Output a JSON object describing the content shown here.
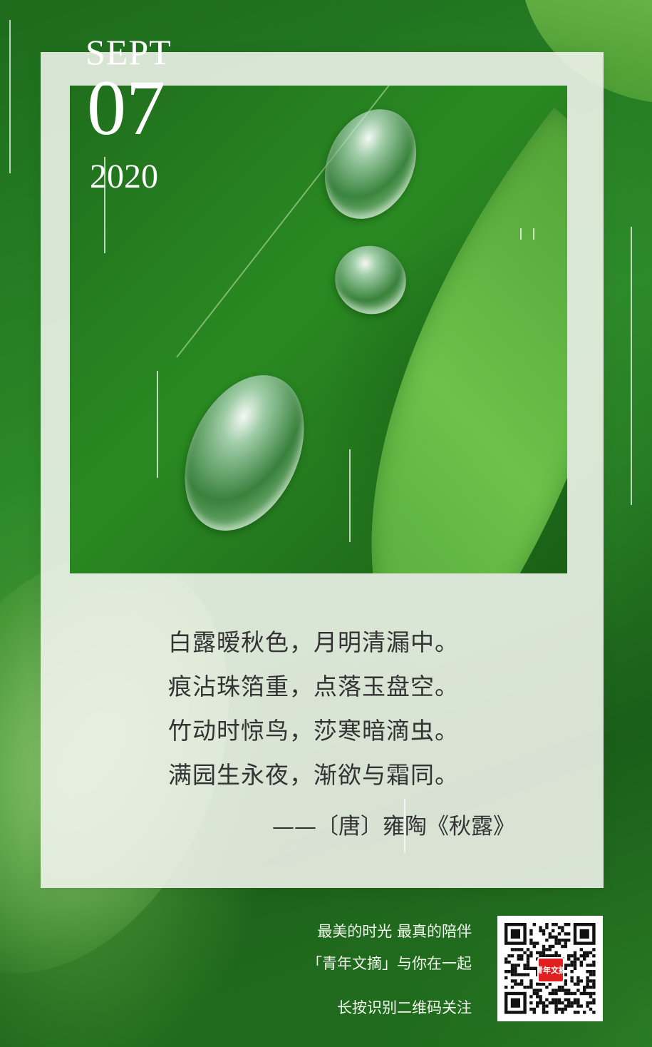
{
  "date": {
    "month": "SEPT",
    "day": "07",
    "year": "2020"
  },
  "poem": {
    "lines": [
      "白露暧秋色，月明清漏中。",
      "痕沾珠箔重，点落玉盘空。",
      "竹动时惊鸟，莎寒暗滴虫。",
      "满园生永夜，渐欲与霜同。"
    ],
    "source": "——〔唐〕雍陶《秋露》"
  },
  "footer": {
    "line1": "最美的时光  最真的陪伴",
    "line2": "「青年文摘」与你在一起",
    "line3": "长按识别二维码关注"
  },
  "qr": {
    "logo_text": "青年文摘"
  },
  "colors": {
    "frame": "#f2f5ee",
    "text": "#333333",
    "background": "#2c8a28"
  }
}
